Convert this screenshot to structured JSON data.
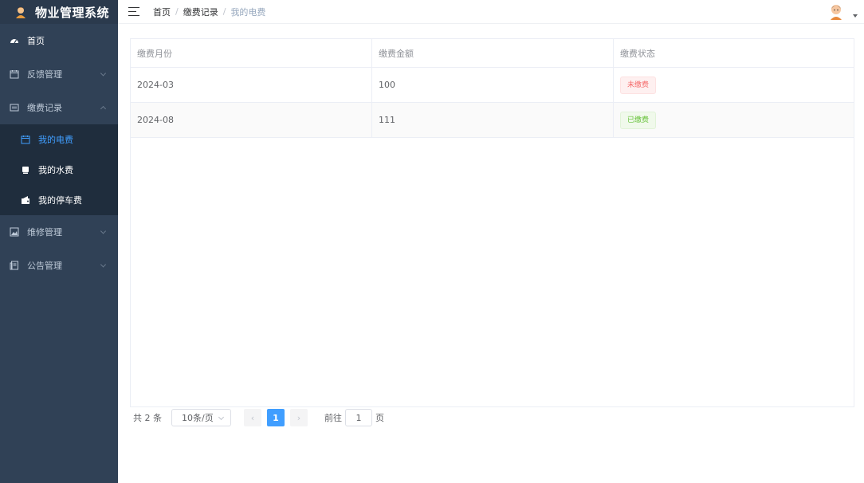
{
  "app": {
    "title": "物业管理系统"
  },
  "sidebar": {
    "items": [
      {
        "label": "首页",
        "icon": "dashboard-icon"
      },
      {
        "label": "反馈管理",
        "icon": "calendar-icon",
        "expanded": false
      },
      {
        "label": "缴费记录",
        "icon": "bill-icon",
        "expanded": true,
        "children": [
          {
            "label": "我的电费",
            "icon": "calendar-icon",
            "active": true
          },
          {
            "label": "我的水费",
            "icon": "cup-icon"
          },
          {
            "label": "我的停车费",
            "icon": "wallet-icon"
          }
        ]
      },
      {
        "label": "维修管理",
        "icon": "picture-icon",
        "expanded": false
      },
      {
        "label": "公告管理",
        "icon": "document-icon",
        "expanded": false
      }
    ]
  },
  "header": {
    "breadcrumb": [
      "首页",
      "缴费记录",
      "我的电费"
    ],
    "separator": "/"
  },
  "table": {
    "columns": [
      "缴费月份",
      "缴费金额",
      "缴费状态"
    ],
    "rows": [
      {
        "month": "2024-03",
        "amount": "100",
        "status": "未缴费",
        "status_type": "danger"
      },
      {
        "month": "2024-08",
        "amount": "111",
        "status": "已缴费",
        "status_type": "success"
      }
    ]
  },
  "pagination": {
    "total_text": "共 2 条",
    "page_size": "10条/页",
    "prev": "‹",
    "next": "›",
    "current_page": "1",
    "goto_label": "前往",
    "goto_value": "1",
    "page_suffix": "页"
  },
  "colors": {
    "sidebar_bg": "#304156",
    "submenu_bg": "#1f2d3d",
    "accent": "#409eff",
    "danger": "#f56c6c",
    "success": "#67c23a"
  }
}
